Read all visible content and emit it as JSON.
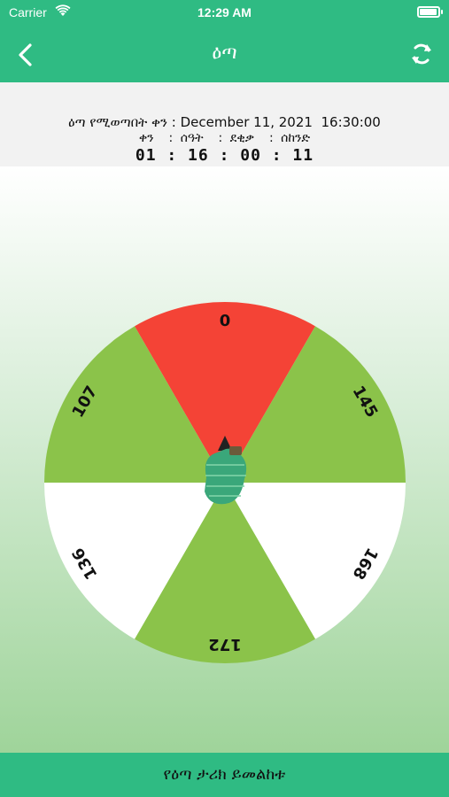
{
  "status_bar": {
    "carrier": "Carrier",
    "time": "12:29 AM"
  },
  "nav": {
    "title": "ዕጣ",
    "back_icon": "chevron-left-icon",
    "refresh_icon": "refresh-icon"
  },
  "draw_info": {
    "label": "ዕጣ የሚወጣበት ቀን",
    "date": "December 11, 2021  16:30:00",
    "units": "ቀን  : ሰዓት  : ደቂቃ  : ሰከንድ",
    "countdown": "01 : 16 : 00 : 11"
  },
  "wheel": {
    "segments": [
      {
        "label": "0",
        "color": "#f44336"
      },
      {
        "label": "145",
        "color": "#8bc34a"
      },
      {
        "label": "168",
        "color": "#ffffff"
      },
      {
        "label": "172",
        "color": "#8bc34a"
      },
      {
        "label": "136",
        "color": "#ffffff"
      },
      {
        "label": "107",
        "color": "#8bc34a"
      }
    ]
  },
  "colors": {
    "brand": "#2fbb83",
    "background_bottom": "#9fd49a"
  },
  "bottom_button": {
    "label": "የዕጣ ታሪክ ይመልከቱ"
  }
}
